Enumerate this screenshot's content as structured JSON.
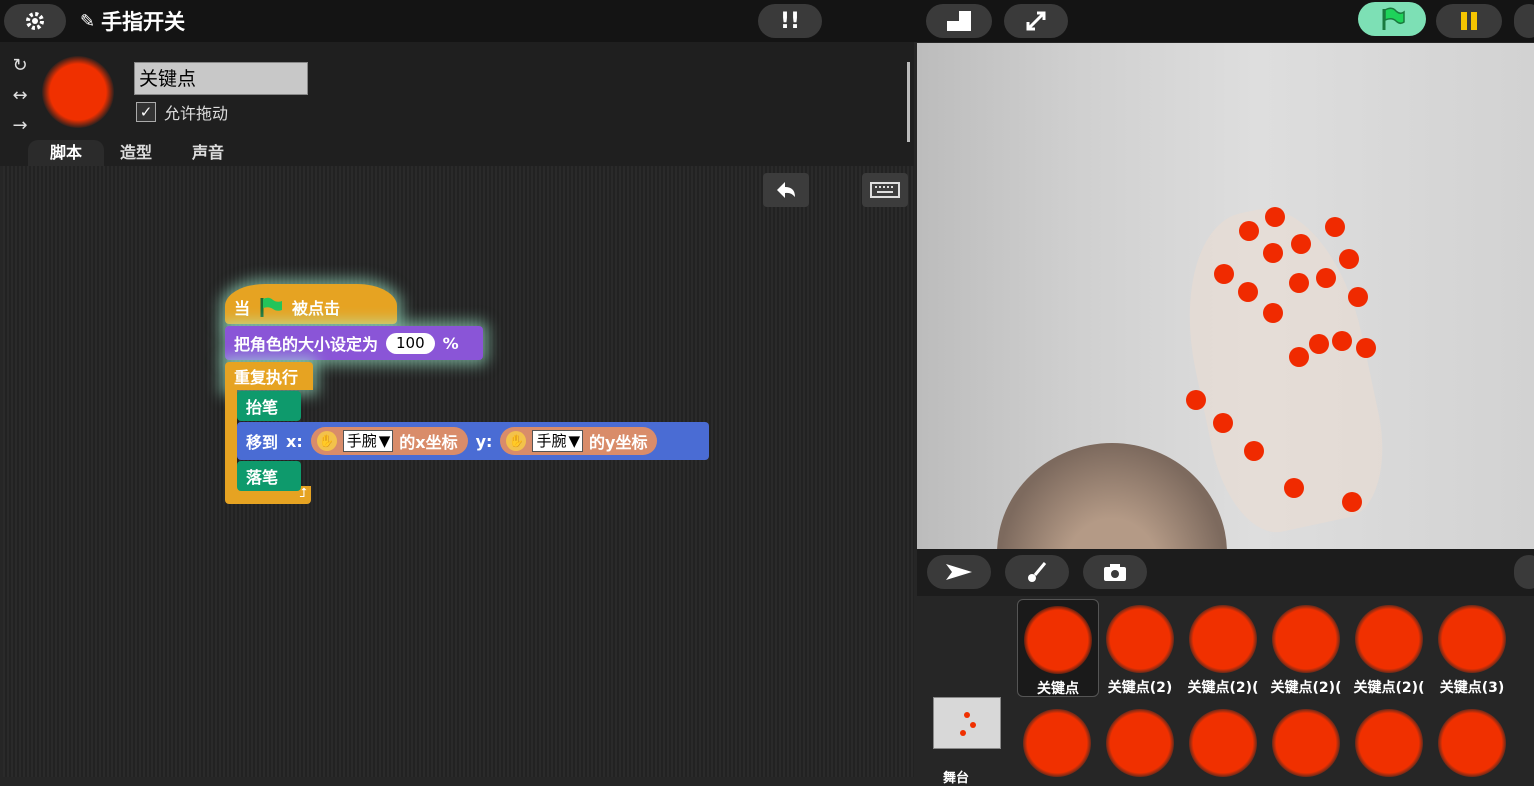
{
  "topbar": {
    "settings_icon": "gear-icon",
    "project_title": "手指开关",
    "edit_icon": "pencil-icon",
    "footprint_icon": "footsteps-icon",
    "layout_icon": "small-stage-icon",
    "fullscreen_icon": "expand-icon",
    "green_flag_icon": "green-flag-icon",
    "stop_icon": "pause-icon",
    "colors": {
      "green_flag_bg": "#7de0b5",
      "pause_color": "#f5c400"
    }
  },
  "sprite": {
    "name": "关键点",
    "draggable_label": "允许拖动",
    "draggable_checked": "✓",
    "rotation_icons": [
      "rotate-all-around-icon",
      "left-right-icon",
      "dont-rotate-icon"
    ],
    "color": "#f03000"
  },
  "tabs": [
    {
      "label": "脚本",
      "active": true
    },
    {
      "label": "造型",
      "active": false
    },
    {
      "label": "声音",
      "active": false
    }
  ],
  "script_tools": {
    "undo_icon": "undo-icon",
    "keyboard_icon": "keyboard-icon"
  },
  "blocks": {
    "hat_when": "当",
    "hat_clicked": "被点击",
    "set_size_label": "把角色的大小设定为",
    "set_size_value": "100",
    "set_size_unit": "%",
    "forever": "重复执行",
    "pen_up": "抬笔",
    "goto_label": "移到",
    "goto_x": "x:",
    "goto_y": "y:",
    "reporter_x_dropdown": "手腕",
    "reporter_x_suffix": "的x坐标",
    "reporter_y_dropdown": "手腕",
    "reporter_y_suffix": "的y坐标",
    "pen_down": "落笔"
  },
  "stage_tools": {
    "select_icon": "arrow-cursor-icon",
    "paint_icon": "paintbrush-icon",
    "camera_icon": "camera-icon"
  },
  "sprites": [
    {
      "label": "关键点",
      "selected": true
    },
    {
      "label": "关键点(2)"
    },
    {
      "label": "关键点(2)("
    },
    {
      "label": "关键点(2)("
    },
    {
      "label": "关键点(2)("
    },
    {
      "label": "关键点(3)"
    }
  ],
  "stage_thumb_label": "舞台"
}
